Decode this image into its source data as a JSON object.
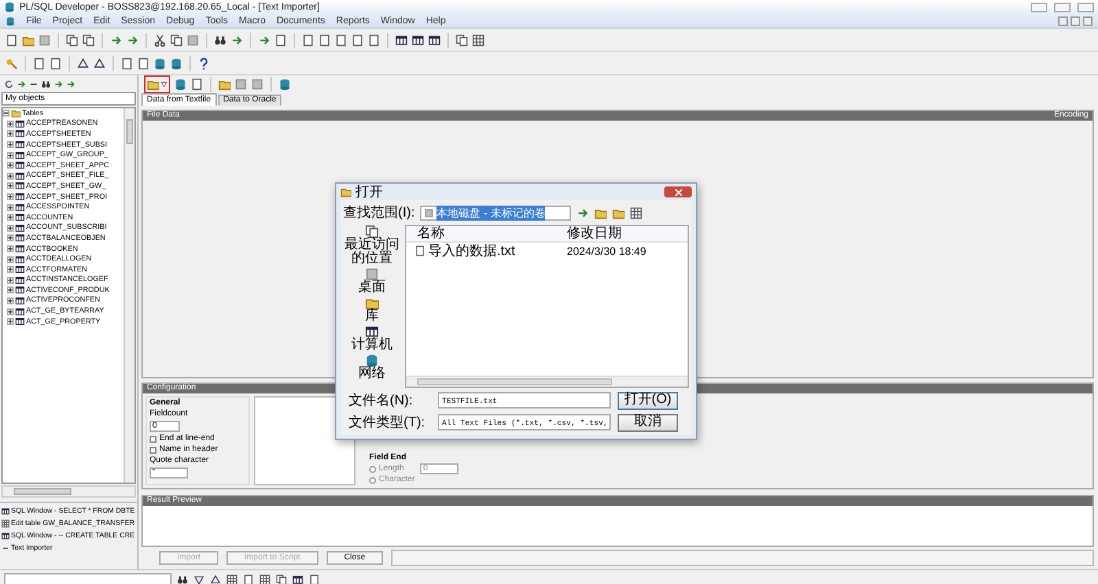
{
  "window": {
    "title": "PL/SQL Developer - BOSS823@192.168.20.65_Local - [Text Importer]"
  },
  "menu": [
    "File",
    "Project",
    "Edit",
    "Session",
    "Debug",
    "Tools",
    "Macro",
    "Documents",
    "Reports",
    "Window",
    "Help"
  ],
  "object_browser": {
    "filter": "My objects",
    "tree": [
      {
        "label": "Tables",
        "expanded": true,
        "children": [
          {
            "label": "ACCEPTREASONEN",
            "expanded": false
          },
          {
            "label": "ACCEPTSHEETEN",
            "expanded": false
          },
          {
            "label": "ACCEPTSHEET_SUBSI",
            "expanded": false
          },
          {
            "label": "ACCEPT_GW_GROUP_",
            "expanded": false
          },
          {
            "label": "ACCEPT_SHEET_APPC",
            "expanded": false
          },
          {
            "label": "ACCEPT_SHEET_FILE_",
            "expanded": false
          },
          {
            "label": "ACCEPT_SHEET_GW_",
            "expanded": false
          },
          {
            "label": "ACCEPT_SHEET_PROI",
            "expanded": false
          },
          {
            "label": "ACCESSPOINTEN",
            "expanded": false
          },
          {
            "label": "ACCOUNTEN",
            "expanded": false
          },
          {
            "label": "ACCOUNT_SUBSCRIBI",
            "expanded": false
          },
          {
            "label": "ACCTBALANCEOBJEN",
            "expanded": false
          },
          {
            "label": "ACCTBOOKEN",
            "expanded": false
          },
          {
            "label": "ACCTDEALLOGEN",
            "expanded": false
          },
          {
            "label": "ACCTFORMATEN",
            "expanded": false
          },
          {
            "label": "ACCTINSTANCELOGEF",
            "expanded": false
          },
          {
            "label": "ACTIVECONF_PRODUK",
            "expanded": false
          },
          {
            "label": "ACTIVEPROCONFEN",
            "expanded": false
          },
          {
            "label": "ACT_GE_BYTEARRAY",
            "expanded": false
          },
          {
            "label": "ACT_GE_PROPERTY",
            "expanded": false
          }
        ]
      }
    ]
  },
  "window_list": [
    {
      "label": "SQL Window - SELECT * FROM DBTE",
      "kind": "sql"
    },
    {
      "label": "Edit table GW_BALANCE_TRANSFER",
      "kind": "edit"
    },
    {
      "label": "SQL Window - -- CREATE TABLE CRE",
      "kind": "sql"
    },
    {
      "label": "Text Importer",
      "kind": "importer"
    }
  ],
  "importer": {
    "tabs": [
      {
        "label": "Data from Textfile",
        "selected": true
      },
      {
        "label": "Data to Oracle",
        "selected": false
      }
    ],
    "file_data": {
      "title": "File Data",
      "encoding_label": "Encoding"
    },
    "configuration": {
      "title": "Configuration",
      "general": {
        "title": "General",
        "fieldcount_label": "Fieldcount",
        "fieldcount": "0",
        "options": [
          {
            "label": "End at line-end",
            "checked": false
          },
          {
            "label": "Name in header",
            "checked": false
          }
        ],
        "quote_label": "Quote character",
        "quote": "\""
      },
      "field_end": {
        "title": "Field End",
        "options": [
          {
            "label": "Length",
            "selected": false,
            "disabled": true
          },
          {
            "label": "Character",
            "selected": false,
            "disabled": true
          }
        ],
        "value": "0"
      }
    },
    "result_preview": {
      "title": "Result Preview"
    },
    "buttons": [
      {
        "label": "Import",
        "disabled": true
      },
      {
        "label": "Import to Script",
        "disabled": true
      },
      {
        "label": "Close",
        "disabled": false
      }
    ]
  },
  "dialog": {
    "title": "打开",
    "look_in_label": "查找范围(I):",
    "look_in": "本地磁盘 - 未标记的卷",
    "places": [
      {
        "label": "最近访问的位置",
        "kind": "recent"
      },
      {
        "label": "桌面",
        "kind": "desktop"
      },
      {
        "label": "库",
        "kind": "library"
      },
      {
        "label": "计算机",
        "kind": "computer"
      },
      {
        "label": "网络",
        "kind": "network"
      }
    ],
    "columns": [
      "名称",
      "修改日期"
    ],
    "files": [
      {
        "name": "导入的数据.txt",
        "modified": "2024/3/30 18:49"
      }
    ],
    "filename_label": "文件名(N):",
    "filename": "TESTFILE.txt",
    "filetype_label": "文件类型(T):",
    "filetype": "All Text Files (*.txt, *.csv, *.tsv,",
    "open_button": "打开(O)",
    "cancel_button": "取消"
  }
}
